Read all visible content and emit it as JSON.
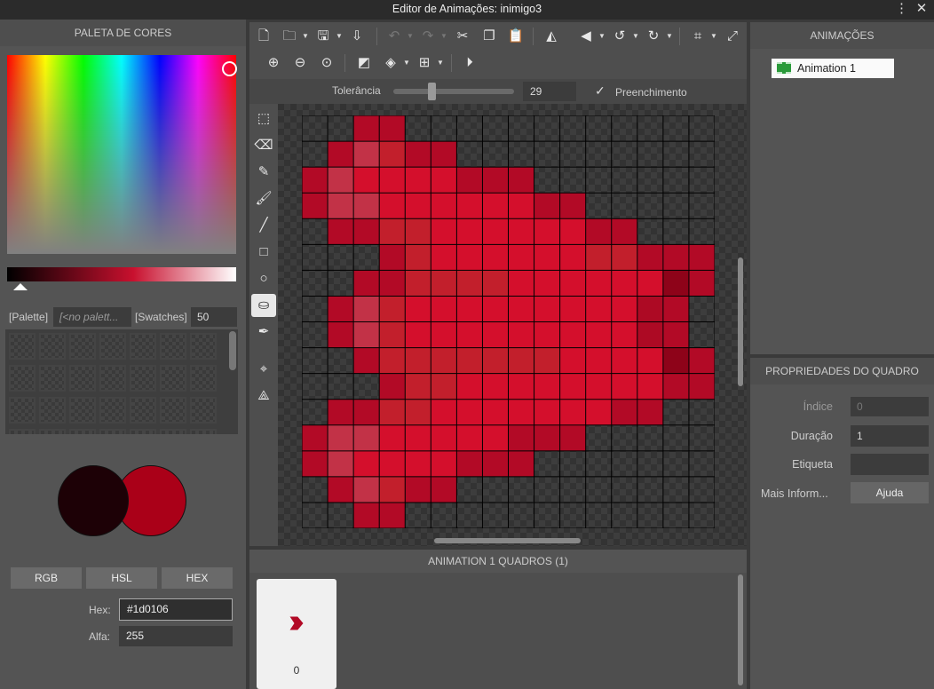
{
  "window": {
    "title": "Editor de Animações: inimigo3"
  },
  "palette": {
    "header": "PALETA DE CORES",
    "palette_label": "[Palette]",
    "palette_value": "[<no palett...",
    "swatches_label": "[Swatches]",
    "swatches_count": "50",
    "modes": [
      "RGB",
      "HSL",
      "HEX"
    ],
    "hex_label": "Hex:",
    "hex_value": "#1d0106",
    "alpha_label": "Alfa:",
    "alpha_value": "255",
    "primary_color": "#1d0106",
    "secondary_color": "#aa0018"
  },
  "toolbar": {
    "row1": [
      "new-file-icon",
      "open-folder-icon",
      "save-icon",
      "export-icon",
      "undo-icon",
      "redo-icon",
      "cut-icon",
      "copy-icon",
      "paste-icon",
      "flip-horizontal-icon",
      "flip-vertical-icon",
      "rotate-left-icon",
      "rotate-right-icon",
      "crop-icon",
      "resize-icon"
    ],
    "row2": [
      "zoom-in-icon",
      "zoom-out-icon",
      "zoom-reset-icon",
      "fill-background-icon",
      "layers-icon",
      "grid-icon",
      "play-icon"
    ]
  },
  "options": {
    "tolerance_label": "Tolerância",
    "tolerance_value": "29",
    "tolerance_fraction": 0.29,
    "fill_label": "Preenchimento",
    "fill_checked": true
  },
  "tools": [
    "selection-icon",
    "eraser-icon",
    "pencil-icon",
    "brush-icon",
    "line-icon",
    "rectangle-icon",
    "ellipse-icon",
    "bucket-fill-icon",
    "eyedropper-icon",
    "crosshair-icon",
    "pivot-icon"
  ],
  "active_tool": "bucket-fill-icon",
  "sprite": {
    "colors": {
      "A": "#b20a26",
      "B": "#c23247",
      "C": "#d40f2c",
      "D": "#c21f2c",
      "E": "#ad0a24",
      "F": "#8e0319"
    },
    "rows": [
      "..AA............",
      ".ABDAA..........",
      "ABCCCCAAA.......",
      "ABBCCCCCCAA.....",
      ".AADDCCCCCCAA...",
      "...ADCCCCCCDDAAA",
      "..AADDDDCCCCCCFA",
      ".ABDCCCCCCCCCEA.",
      ".ABDCCCCCCCCCEA.",
      "..ADDDDDDDCCCCFA",
      "...ADDCCCCCCCCAA",
      ".AADDCCCCCCCAA..",
      "ABBCCCCCAAA.....",
      "ABCCCCAAA.......",
      ".ABDAA..........",
      "..AA............"
    ]
  },
  "frames_panel": {
    "header": "ANIMATION 1 QUADROS (1)",
    "frames": [
      {
        "number": "0"
      }
    ]
  },
  "animations": {
    "header": "ANIMAÇÕES",
    "items": [
      "Animation 1"
    ]
  },
  "frame_props": {
    "header": "PROPRIEDADES DO QUADRO",
    "index_label": "Índice",
    "index_value": "0",
    "duration_label": "Duração",
    "duration_value": "1",
    "tag_label": "Etiqueta",
    "tag_value": "",
    "more_label": "Mais Inform...",
    "help_button": "Ajuda"
  }
}
